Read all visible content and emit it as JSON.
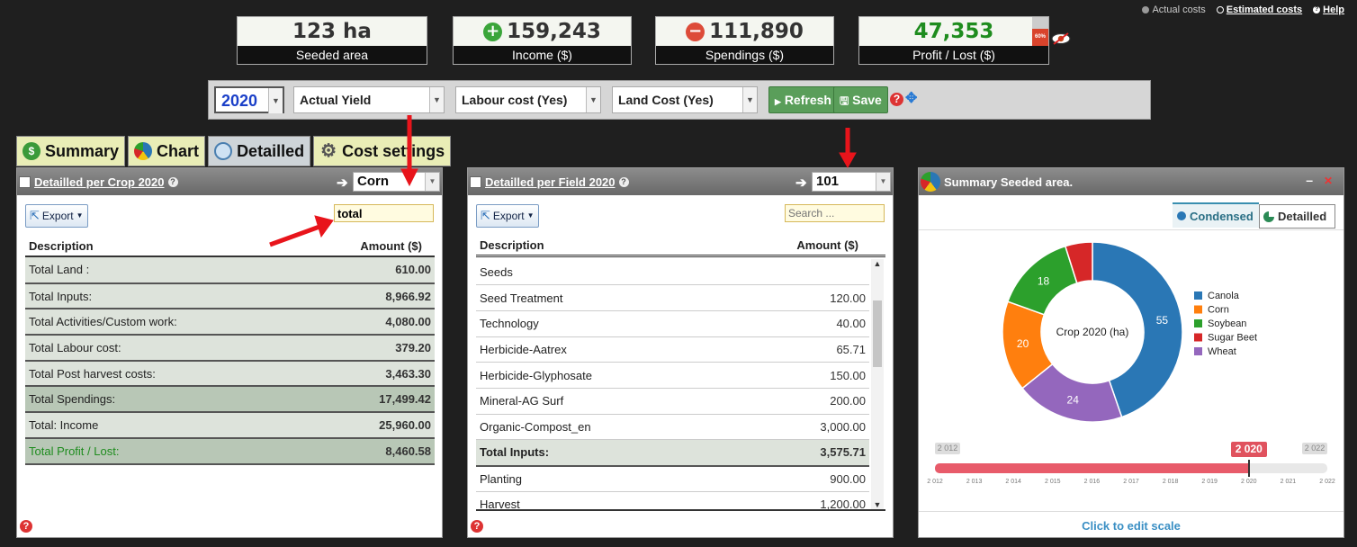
{
  "topbar": {
    "actual_costs": "Actual costs",
    "estimated_costs": "Estimated costs",
    "help": "Help"
  },
  "stats": [
    {
      "value": "123 ha",
      "label": "Seeded area"
    },
    {
      "value": "159,243",
      "label": "Income ($)",
      "icon": "plus-icon"
    },
    {
      "value": "111,890",
      "label": "Spendings ($)",
      "icon": "minus-icon"
    },
    {
      "value": "47,353",
      "label": "Profit / Lost ($)",
      "badge": "60%"
    }
  ],
  "toolbar": {
    "year": "2020",
    "yield": "Actual Yield",
    "labour": "Labour cost (Yes)",
    "land": "Land Cost (Yes)",
    "refresh": "Refresh",
    "save": "Save"
  },
  "tabs": [
    "Summary",
    "Chart",
    "Detailled",
    "Cost settings"
  ],
  "crop_panel": {
    "title": "Detailled per Crop 2020",
    "crop": "Corn",
    "export": "Export",
    "search_value": "total",
    "col_desc": "Description",
    "col_amount": "Amount ($)",
    "rows": [
      {
        "desc": "Total Land :",
        "amount": "610.00"
      },
      {
        "desc": "Total Inputs:",
        "amount": "8,966.92"
      },
      {
        "desc": "Total Activities/Custom work:",
        "amount": "4,080.00"
      },
      {
        "desc": "Total Labour cost:",
        "amount": "379.20"
      },
      {
        "desc": "Total Post harvest costs:",
        "amount": "3,463.30"
      },
      {
        "desc": "Total Spendings:",
        "amount": "17,499.42"
      },
      {
        "desc": "Total: Income",
        "amount": "25,960.00"
      },
      {
        "desc": "Total Profit / Lost:",
        "amount": "8,460.58"
      }
    ]
  },
  "field_panel": {
    "title": "Detailled per Field 2020",
    "field": "101",
    "export": "Export",
    "search_placeholder": "Search ...",
    "col_desc": "Description",
    "col_amount": "Amount ($)",
    "rows": [
      {
        "desc": "Seeds",
        "amount": ""
      },
      {
        "desc": "Seed Treatment",
        "amount": "120.00"
      },
      {
        "desc": "Technology",
        "amount": "40.00"
      },
      {
        "desc": "Herbicide-Aatrex",
        "amount": "65.71"
      },
      {
        "desc": "Herbicide-Glyphosate",
        "amount": "150.00"
      },
      {
        "desc": "Mineral-AG Surf",
        "amount": "200.00"
      },
      {
        "desc": "Organic-Compost_en",
        "amount": "3,000.00"
      },
      {
        "desc": "Total Inputs:",
        "amount": "3,575.71"
      },
      {
        "desc": "Planting",
        "amount": "900.00"
      },
      {
        "desc": "Harvest",
        "amount": "1,200.00"
      }
    ]
  },
  "summary_panel": {
    "title": "Summary Seeded area.",
    "tab_condensed": "Condensed",
    "tab_detailed": "Detailled",
    "center_label": "Crop 2020 (ha)",
    "slider_min": "2 012",
    "slider_max": "2 022",
    "slider_value": "2 020",
    "slider_ticks": [
      "2 012",
      "2 013",
      "2 014",
      "2 015",
      "2 016",
      "2 017",
      "2 018",
      "2 019",
      "2 020",
      "2 021",
      "2 022"
    ],
    "edit_scale": "Click to edit scale",
    "slider_fraction": 0.8
  },
  "chart_data": {
    "type": "pie",
    "title": "Crop 2020 (ha)",
    "legend_position": "right",
    "categories": [
      "Canola",
      "Corn",
      "Soybean",
      "Sugar Beet",
      "Wheat"
    ],
    "values": [
      55,
      20,
      18,
      6,
      24
    ],
    "colors": [
      "#2a77b5",
      "#ff7f0e",
      "#2ca02c",
      "#d62728",
      "#9467bd"
    ]
  }
}
